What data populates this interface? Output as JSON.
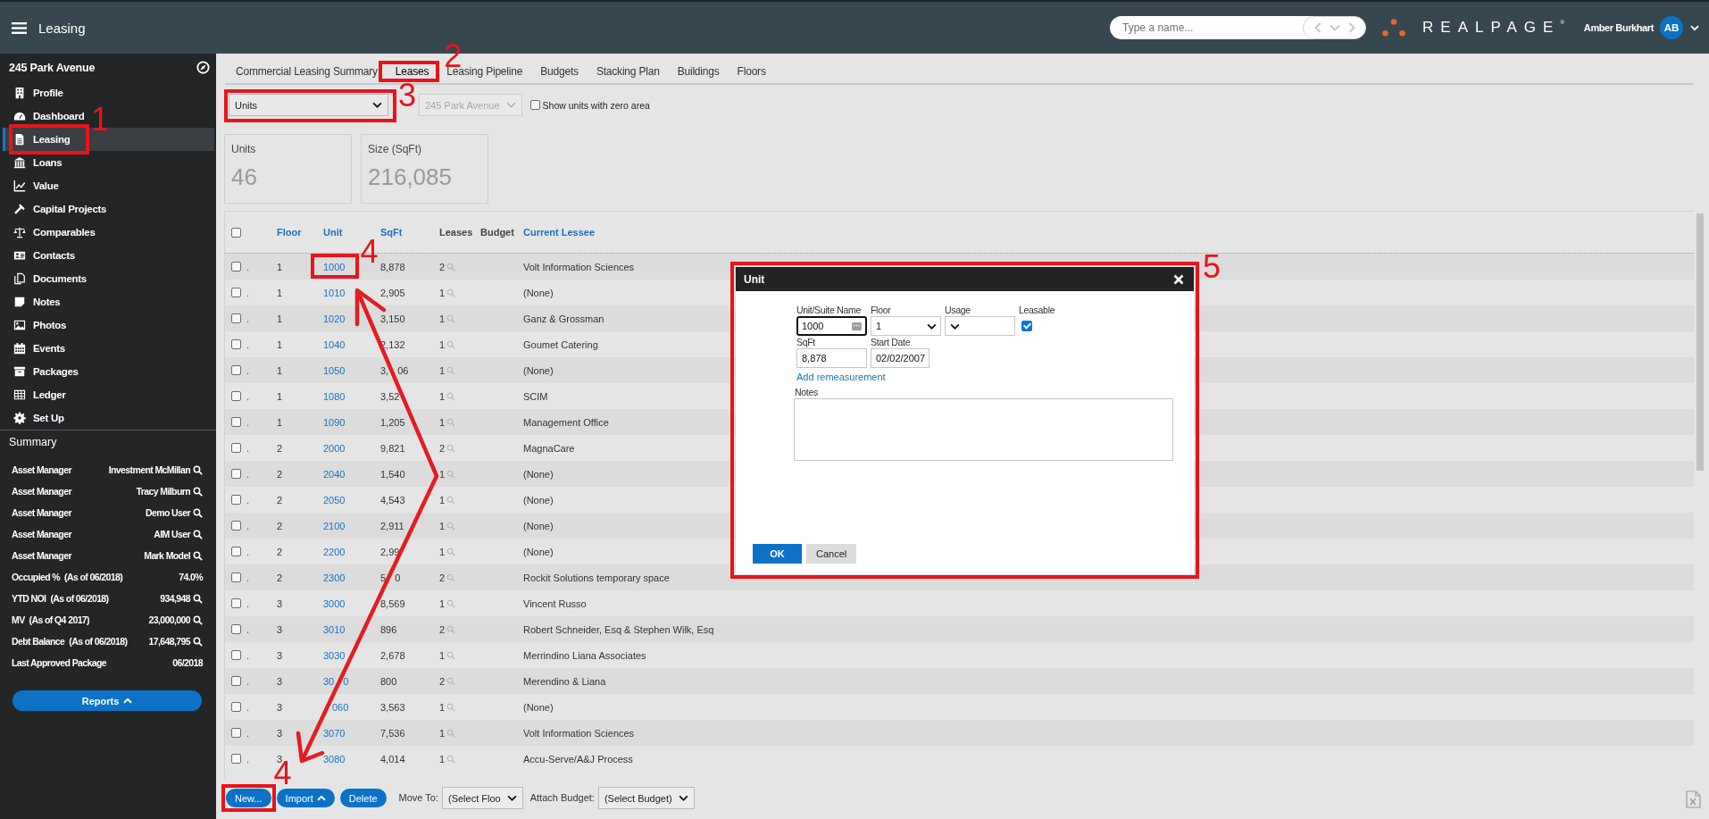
{
  "topbar": {
    "title": "Leasing",
    "search": {
      "placeholder": "Type a name..."
    },
    "logo": "REALPAGE$^{®}$",
    "user": {
      "name": "Amber Burkhart",
      "initials": "AB"
    }
  },
  "sidebar": {
    "title": "245 Park Avenue",
    "items": [
      {
        "label": "Profile",
        "selected": false
      },
      {
        "label": "Dashboard",
        "selected": false
      },
      {
        "label": "Leasing",
        "selected": true,
        "callout": "1"
      },
      {
        "label": "Loans",
        "selected": false
      },
      {
        "label": "Value",
        "selected": false
      },
      {
        "label": "Capital Projects",
        "selected": false
      },
      {
        "label": "Comparables",
        "selected": false
      },
      {
        "label": "Contacts",
        "selected": false
      },
      {
        "label": "Documents",
        "selected": false
      },
      {
        "label": "Notes",
        "selected": false
      },
      {
        "label": "Photos",
        "selected": false
      },
      {
        "label": "Events",
        "selected": false
      },
      {
        "label": "Packages",
        "selected": false
      },
      {
        "label": "Ledger",
        "selected": false
      },
      {
        "label": "Set Up",
        "selected": false
      }
    ],
    "summary": {
      "title": "Summary",
      "rows": [
        {
          "label": "Asset Manager",
          "value": "Investment McMillan",
          "lookup": true
        },
        {
          "label": "Asset Manager",
          "value": "Tracy Milburn",
          "lookup": true
        },
        {
          "label": "Asset Manager",
          "value": "Demo User",
          "lookup": true
        },
        {
          "label": "Asset Manager",
          "value": "AIM User",
          "lookup": true
        },
        {
          "label": "Asset Manager",
          "value": "Mark Model",
          "lookup": true
        },
        {
          "label": "Occupied %",
          "note": "(As of 06/2018)",
          "value": "74.0%",
          "lookup": false
        },
        {
          "label": "YTD NOI",
          "note": "(As of 06/2018)",
          "value": "934,948",
          "lookup": true
        },
        {
          "label": "MV",
          "note": "(As of Q4 2017)",
          "value": "23,000,000",
          "lookup": true
        },
        {
          "label": "Debt Balance",
          "note": "(As of 06/2018)",
          "value": "17,648,795",
          "lookup": true
        },
        {
          "label": "Last Approved Package",
          "value": "06/2018",
          "lookup": false
        }
      ]
    },
    "reports_button": {
      "label": "Reports",
      "menu": true
    }
  },
  "tabs": [
    {
      "label": "Commercial Leasing Summary",
      "selected": false
    },
    {
      "label": "Leases",
      "selected": true,
      "callout": "2"
    },
    {
      "label": "Leasing Pipeline",
      "selected": false
    },
    {
      "label": "Budgets",
      "selected": false
    },
    {
      "label": "Stacking Plan",
      "selected": false
    },
    {
      "label": "Buildings",
      "selected": false
    },
    {
      "label": "Floors",
      "selected": false
    }
  ],
  "filters": {
    "view_select": {
      "value": "Units",
      "callout": "3"
    },
    "property_select": {
      "value": "245 Park Avenue",
      "disabled": true
    },
    "zero_area": {
      "label": "Show units with zero area",
      "checked": false
    }
  },
  "stats": [
    {
      "label": "Units",
      "value": "46"
    },
    {
      "label": "Size (SqFt)",
      "value": "216,085"
    }
  ],
  "table": {
    "select_all_checked": false,
    "columns": [
      {
        "label": "Floor",
        "sortable": true
      },
      {
        "label": "Unit",
        "sortable": true
      },
      {
        "label": "SqFt",
        "sortable": true
      },
      {
        "label": "Leases",
        "sortable": false
      },
      {
        "label": "Budget",
        "sortable": false
      },
      {
        "label": "Current Lessee",
        "sortable": true
      }
    ],
    "rows": [
      {
        "checked": false,
        "column_2": ".",
        "floor": "1",
        "unit": "1000",
        "sqft": "8,878",
        "leases": "2",
        "lessee": "Volt Information Sciences",
        "callout": "4"
      },
      {
        "checked": false,
        "column_2": ".",
        "floor": "1",
        "unit": "1010",
        "sqft": "2,905",
        "leases": "1",
        "lessee": "(None)"
      },
      {
        "checked": false,
        "column_2": ".",
        "floor": "1",
        "unit": "1020",
        "sqft": "3,150",
        "leases": "1",
        "lessee": "Ganz & Grossman"
      },
      {
        "checked": false,
        "column_2": ".",
        "floor": "1",
        "unit": "1040",
        "sqft": "2,132",
        "leases": "1",
        "lessee": "Goumet Catering"
      },
      {
        "checked": false,
        "column_2": ".",
        "floor": "1",
        "unit": "1050",
        "sqft": {
          "shown": [
            "3,",
            "06"
          ],
          "covered_start": false
        },
        "leases": "1",
        "lessee": "(None)"
      },
      {
        "checked": false,
        "column_2": ".",
        "floor": "1",
        "unit": "1080",
        "sqft": "3,52",
        "leases": "1",
        "lessee": "SCIM"
      },
      {
        "checked": false,
        "column_2": ".",
        "floor": "1",
        "unit": "1090",
        "sqft": "1,205",
        "leases": "1",
        "lessee": "Management Office"
      },
      {
        "checked": false,
        "column_2": ".",
        "floor": "2",
        "unit": "2000",
        "sqft": "9,821",
        "leases": "2",
        "lessee": "MagnaCare"
      },
      {
        "checked": false,
        "column_2": ".",
        "floor": "2",
        "unit": "2040",
        "sqft": "1,540",
        "leases": "1",
        "lessee": "(None)"
      },
      {
        "checked": false,
        "column_2": ".",
        "floor": "2",
        "unit": "2050",
        "sqft": "4,543",
        "leases": "1",
        "lessee": "(None)"
      },
      {
        "checked": false,
        "column_2": ".",
        "floor": "2",
        "unit": "2100",
        "sqft": "2,911",
        "leases": "1",
        "lessee": "(None)"
      },
      {
        "checked": false,
        "column_2": ".",
        "floor": "2",
        "unit": "2200",
        "sqft": "2,99",
        "leases": "1",
        "lessee": "(None)"
      },
      {
        "checked": false,
        "column_2": ".",
        "floor": "2",
        "unit": "2300",
        "sqft": {
          "shown": [
            "5",
            "0"
          ],
          "covered_start": false
        },
        "leases": "2",
        "lessee": "Rockit Solutions temporary space"
      },
      {
        "checked": false,
        "column_2": ".",
        "floor": "3",
        "unit": "3000",
        "sqft": "8,569",
        "leases": "1",
        "lessee": "Vincent Russo"
      },
      {
        "checked": false,
        "column_2": ".",
        "floor": "3",
        "unit": "3010",
        "sqft": "896",
        "leases": "2",
        "lessee": "Robert Schneider, Esq & Stephen Wilk, Esq"
      },
      {
        "checked": false,
        "column_2": ".",
        "floor": "3",
        "unit": "3030",
        "sqft": "2,678",
        "leases": "1",
        "lessee": "Merrindino Liana Associates"
      },
      {
        "checked": false,
        "column_2": ".",
        "floor": "3",
        "unit": {
          "shown": [
            "30",
            "0"
          ],
          "covered_start": false
        },
        "sqft": "800",
        "leases": "2",
        "lessee": "Merendino & Liana"
      },
      {
        "checked": false,
        "column_2": ".",
        "floor": "3",
        "unit": {
          "shown": [
            "060"
          ],
          "covered_start": true
        },
        "sqft": "3,563",
        "leases": "1",
        "lessee": "(None)"
      },
      {
        "checked": false,
        "column_2": ".",
        "floor": "3",
        "unit": "3070",
        "sqft": "7,536",
        "leases": "1",
        "lessee": "Volt Information Sciences"
      },
      {
        "checked": false,
        "column_2": ".",
        "floor": "3",
        "unit": "3080",
        "sqft": "4,014",
        "leases": "1",
        "lessee": "Accu-Serve/A&J Process"
      }
    ]
  },
  "footer": {
    "buttons": [
      {
        "label": "New...",
        "menu": false,
        "callout": "4"
      },
      {
        "label": "Import",
        "menu": true
      },
      {
        "label": "Delete",
        "menu": false
      }
    ],
    "move_to": {
      "label": "Move To:",
      "value": "(Select Floo"
    },
    "attach_budget": {
      "label": "Attach Budget:",
      "value": "(Select Budget)"
    }
  },
  "dialog": {
    "title": "Unit",
    "callout": "5",
    "field_rows": [
      {
        "fields": [
          {
            "kind": "text",
            "label": "Unit/Suite Name",
            "value": "1000",
            "focused": true,
            "picker": true
          },
          {
            "kind": "select",
            "label": "Floor",
            "value": "1"
          },
          {
            "kind": "select",
            "label": "Usage"
          },
          {
            "kind": "checkbox",
            "label": "Leasable",
            "checked": true
          }
        ]
      },
      {
        "fields": [
          {
            "kind": "text",
            "label": "SqFt",
            "value": "8,878",
            "focused": false,
            "picker": false
          },
          {
            "kind": "date",
            "label": "Start Date",
            "value": "02/02/2007",
            "focused": false,
            "picker": false
          }
        ]
      }
    ],
    "link": "Add remeasurement",
    "notes": {
      "label": "Notes"
    },
    "buttons": [
      {
        "label": "OK",
        "primary": true
      },
      {
        "label": "Cancel",
        "primary": false
      }
    ]
  }
}
